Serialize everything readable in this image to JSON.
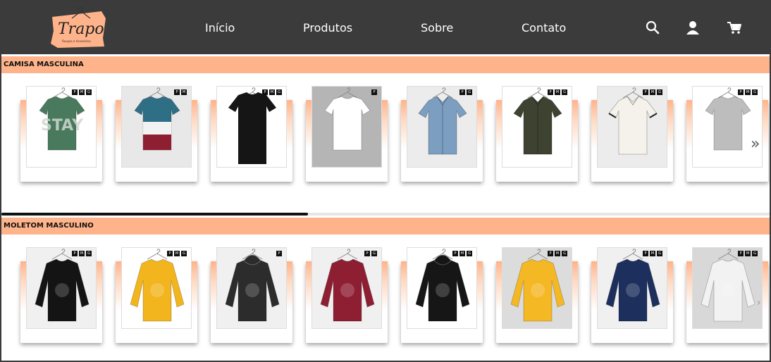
{
  "brand": {
    "name": "Trapo",
    "tagline": "Roupas e Acessórios",
    "colors": {
      "header": "#3b3b3b",
      "accent": "#ffb38a"
    }
  },
  "nav": {
    "links": [
      "Início",
      "Produtos",
      "Sobre",
      "Contato"
    ],
    "icons": [
      "search-icon",
      "user-icon",
      "cart-icon"
    ]
  },
  "sections": [
    {
      "title": "CAMISA MASCULINA",
      "items": [
        {
          "kind": "tshirt",
          "color": "#4a7a5e",
          "print": "STAY",
          "bg": "#ffffff",
          "sizes": [
            "P",
            "M",
            "G"
          ]
        },
        {
          "kind": "tshirt-block",
          "color": "#2f6f86",
          "bg": "#e8e8e8",
          "sizes": [
            "P",
            "M"
          ]
        },
        {
          "kind": "tshirt-long",
          "color": "#151515",
          "bg": "#ffffff",
          "sizes": [
            "P",
            "M",
            "G"
          ]
        },
        {
          "kind": "tshirt",
          "color": "#ffffff",
          "bg": "#b5b5b5",
          "sizes": [
            "P"
          ]
        },
        {
          "kind": "shirt",
          "color": "#7c9ec0",
          "bg": "#ececec",
          "sizes": [
            "P",
            "G"
          ]
        },
        {
          "kind": "shirt",
          "color": "#3e4230",
          "bg": "#ffffff",
          "sizes": [
            "P",
            "M",
            "G"
          ]
        },
        {
          "kind": "polo",
          "color": "#f4f2ea",
          "bg": "#ececec",
          "sizes": [
            "P",
            "M",
            "G"
          ]
        },
        {
          "kind": "tshirt",
          "color": "#bdbdbd",
          "bg": "#ffffff",
          "sizes": [
            "P",
            "M",
            "G"
          ]
        }
      ]
    },
    {
      "title": "MOLETOM MASCULINO",
      "items": [
        {
          "kind": "sweatshirt",
          "color": "#141414",
          "bg": "#f0f0f0",
          "sizes": [
            "P",
            "M",
            "G"
          ]
        },
        {
          "kind": "sweatshirt",
          "color": "#f2b51e",
          "bg": "#ffffff",
          "sizes": [
            "P",
            "M",
            "G"
          ]
        },
        {
          "kind": "hoodie",
          "color": "#2c2c2c",
          "bg": "#f0f0f0",
          "sizes": [
            "P"
          ]
        },
        {
          "kind": "sweatshirt",
          "color": "#8e1f32",
          "bg": "#f0f0f0",
          "sizes": [
            "P",
            "G"
          ]
        },
        {
          "kind": "hoodie",
          "color": "#161616",
          "bg": "#ffffff",
          "sizes": [
            "P",
            "M",
            "G"
          ]
        },
        {
          "kind": "sweatshirt",
          "color": "#f5b825",
          "bg": "#dcdcdc",
          "sizes": [
            "P",
            "M",
            "G"
          ]
        },
        {
          "kind": "sweatshirt",
          "color": "#1d2f5c",
          "bg": "#f0f0f0",
          "sizes": [
            "P",
            "M",
            "G"
          ]
        },
        {
          "kind": "sweatshirt",
          "color": "#f2f2f2",
          "bg": "#d8d8d8",
          "sizes": [
            "P",
            "M",
            "G"
          ]
        }
      ]
    }
  ]
}
